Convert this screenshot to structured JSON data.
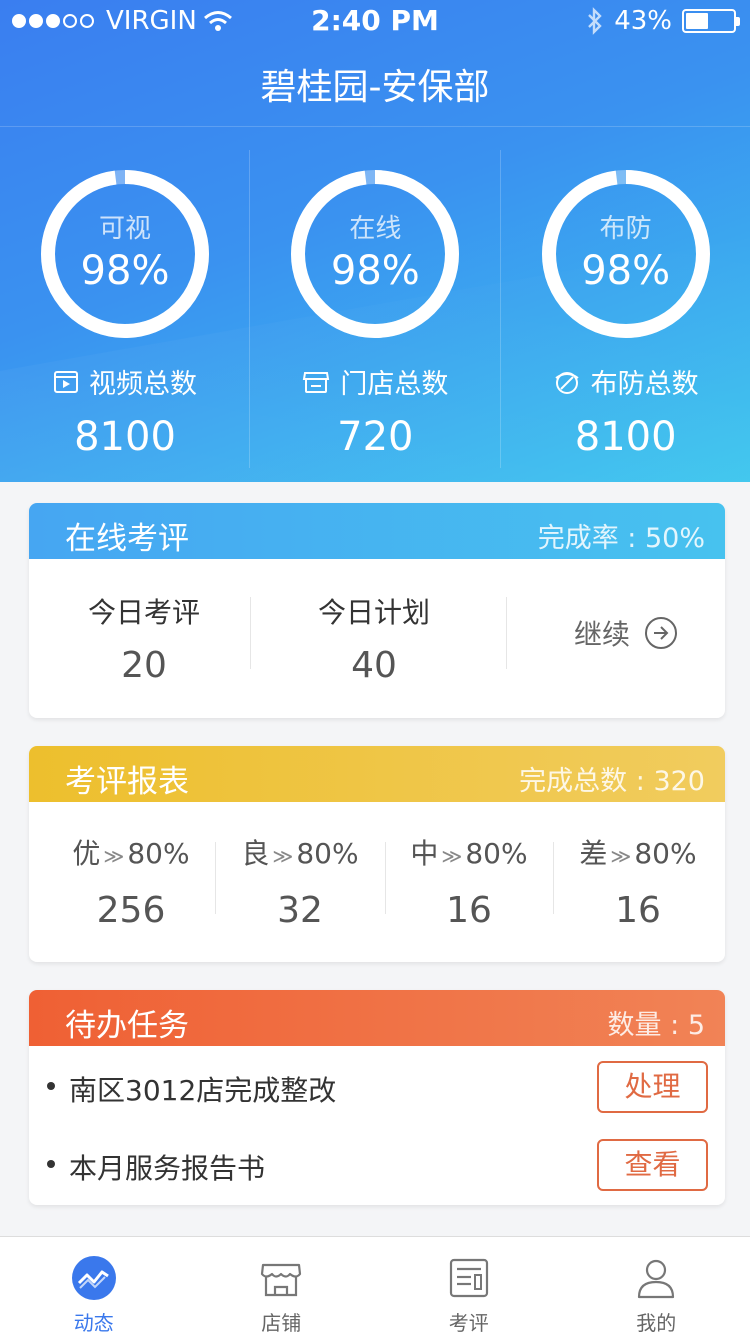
{
  "status_bar": {
    "carrier": "VIRGIN",
    "time": "2:40 PM",
    "battery": "43%",
    "battery_level": 0.43,
    "signal_bars": 3
  },
  "nav": {
    "title": "碧桂园-安保部"
  },
  "colors": {
    "primary": "#3a7ef0",
    "eval_header": "#46a6f2",
    "report_header": "#edbf2d",
    "task_header": "#ef6034",
    "tab_active": "#3a78ec"
  },
  "stats": [
    {
      "ring_label": "可视",
      "percent": "98%",
      "percent_value": 0.98,
      "icon": "video-icon",
      "sub_label": "视频总数",
      "total": "8100"
    },
    {
      "ring_label": "在线",
      "percent": "98%",
      "percent_value": 0.98,
      "icon": "store-icon",
      "sub_label": "门店总数",
      "total": "720"
    },
    {
      "ring_label": "布防",
      "percent": "98%",
      "percent_value": 0.98,
      "icon": "shield-icon",
      "sub_label": "布防总数",
      "total": "8100"
    }
  ],
  "online_eval": {
    "title": "在线考评",
    "rate_label": "完成率",
    "rate_value": "50%",
    "today_eval_label": "今日考评",
    "today_eval_value": "20",
    "today_plan_label": "今日计划",
    "today_plan_value": "40",
    "continue_label": "继续"
  },
  "eval_report": {
    "title": "考评报表",
    "total_label": "完成总数",
    "total_value": "320",
    "grades": [
      {
        "name": "优",
        "sep": "≫",
        "pct": "80%",
        "count": "256"
      },
      {
        "name": "良",
        "sep": "≫",
        "pct": "80%",
        "count": "32"
      },
      {
        "name": "中",
        "sep": "≫",
        "pct": "80%",
        "count": "16"
      },
      {
        "name": "差",
        "sep": "≫",
        "pct": "80%",
        "count": "16"
      }
    ]
  },
  "tasks": {
    "title": "待办任务",
    "count_label": "数量",
    "count_value": "5",
    "items": [
      {
        "text": "南区3012店完成整改",
        "action": "处理"
      },
      {
        "text": "本月服务报告书",
        "action": "查看"
      }
    ]
  },
  "tabbar": {
    "items": [
      {
        "label": "动态",
        "icon": "trend-icon",
        "active": true
      },
      {
        "label": "店铺",
        "icon": "shop-icon",
        "active": false
      },
      {
        "label": "考评",
        "icon": "report-icon",
        "active": false
      },
      {
        "label": "我的",
        "icon": "user-icon",
        "active": false
      }
    ]
  }
}
